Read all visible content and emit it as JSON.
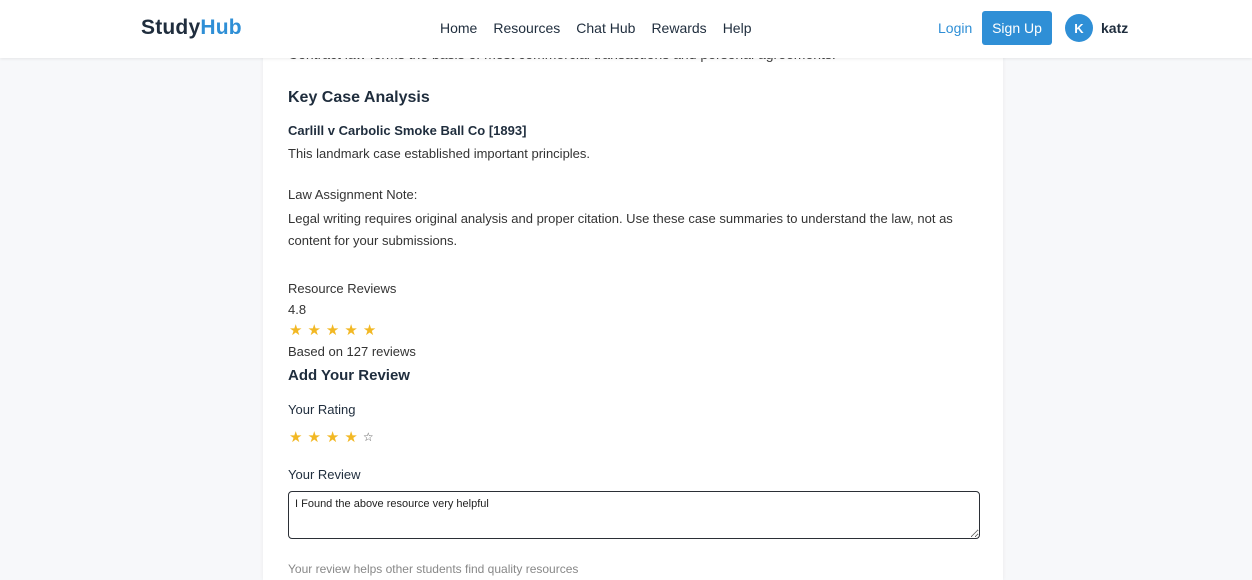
{
  "nav": {
    "brand_part1": "Study",
    "brand_part2": "Hub",
    "links": [
      "Home",
      "Resources",
      "Chat Hub",
      "Rewards",
      "Help"
    ],
    "login": "Login",
    "signup": "Sign Up",
    "avatar_initial": "K",
    "username": "katz"
  },
  "content": {
    "cut_line": "Contract law forms the basis of most commercial transactions and personal agreements.",
    "key_case_heading": "Key Case Analysis",
    "case_title": "Carlill v Carbolic Smoke Ball Co [1893]",
    "case_desc": "This landmark case established important principles.",
    "note_label": "Law Assignment Note:",
    "note_line1": "Legal writing requires original analysis and proper citation. Use these case summaries to understand the law, not as",
    "note_line2": "content for your submissions."
  },
  "reviews": {
    "label": "Resource Reviews",
    "average": "4.8",
    "average_stars": 5,
    "based_on": "Based on 127 reviews",
    "add_heading": "Add Your Review",
    "your_rating_label": "Your Rating",
    "your_rating": 4,
    "your_rating_max": 5,
    "your_review_label": "Your Review",
    "review_text": "I Found the above resource very helpful",
    "faded_text": "Your review helps other students find quality resources"
  },
  "colors": {
    "accent": "#2f8fd6",
    "star": "#f2b824"
  }
}
